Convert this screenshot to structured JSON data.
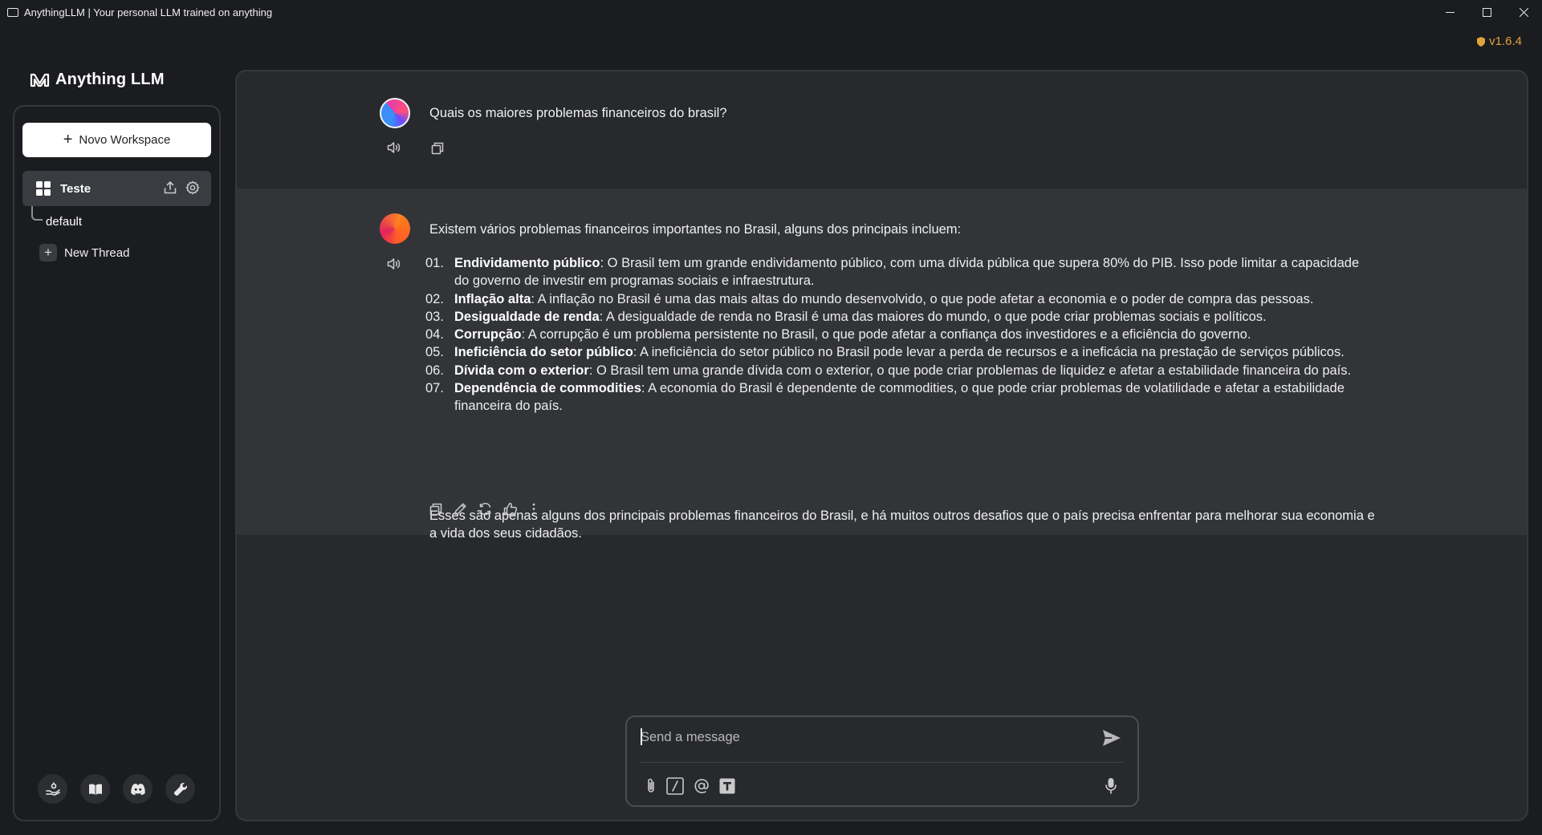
{
  "window": {
    "title": "AnythingLLM | Your personal LLM trained on anything",
    "controls": [
      "minimize-icon",
      "maximize-icon",
      "close-icon"
    ]
  },
  "version": "v1.6.4",
  "brand": {
    "name": "Anything LLM"
  },
  "sidebar": {
    "new_workspace_label": "Novo Workspace",
    "workspace": {
      "name": "Teste"
    },
    "thread_default": "default",
    "new_thread_label": "New Thread",
    "footer_icons": [
      "community-hub-icon",
      "docs-book-icon",
      "discord-icon",
      "settings-wrench-icon"
    ]
  },
  "chat": {
    "user_message": "Quais os maiores problemas financeiros do brasil?",
    "bot_intro": "Existem vários problemas financeiros importantes no Brasil, alguns dos principais incluem:",
    "items": [
      {
        "num": "01.",
        "title": "Endividamento público",
        "text": ": O Brasil tem um grande endividamento público, com uma dívida pública que supera 80% do PIB. Isso pode limitar a capacidade do governo de investir em programas sociais e infraestrutura."
      },
      {
        "num": "02.",
        "title": "Inflação alta",
        "text": ": A inflação no Brasil é uma das mais altas do mundo desenvolvido, o que pode afetar a economia e o poder de compra das pessoas."
      },
      {
        "num": "03.",
        "title": "Desigualdade de renda",
        "text": ": A desigualdade de renda no Brasil é uma das maiores do mundo, o que pode criar problemas sociais e políticos."
      },
      {
        "num": "04.",
        "title": "Corrupção",
        "text": ": A corrupção é um problema persistente no Brasil, o que pode afetar a confiança dos investidores e a eficiência do governo."
      },
      {
        "num": "05.",
        "title": "Ineficiência do setor público",
        "text": ": A ineficiência do setor público no Brasil pode levar a perda de recursos e a ineficácia na prestação de serviços públicos."
      },
      {
        "num": "06.",
        "title": "Dívida com o exterior",
        "text": ": O Brasil tem uma grande dívida com o exterior, o que pode criar problemas de liquidez e afetar a estabilidade financeira do país."
      },
      {
        "num": "07.",
        "title": "Dependência de commodities",
        "text": ": A economia do Brasil é dependente de commodities, o que pode criar problemas de volatilidade e afetar a estabilidade financeira do país."
      }
    ],
    "bot_outro": "Esses são apenas alguns dos principais problemas financeiros do Brasil, e há muitos outros desafios que o país precisa enfrentar para melhorar sua economia e a vida dos seus cidadãos."
  },
  "composer": {
    "placeholder": "Send a message",
    "value": ""
  },
  "colors": {
    "background": "#1b1c1f",
    "panel": "#27292d",
    "bot_message_bg": "#323438",
    "accent_version": "#e0a23b"
  }
}
